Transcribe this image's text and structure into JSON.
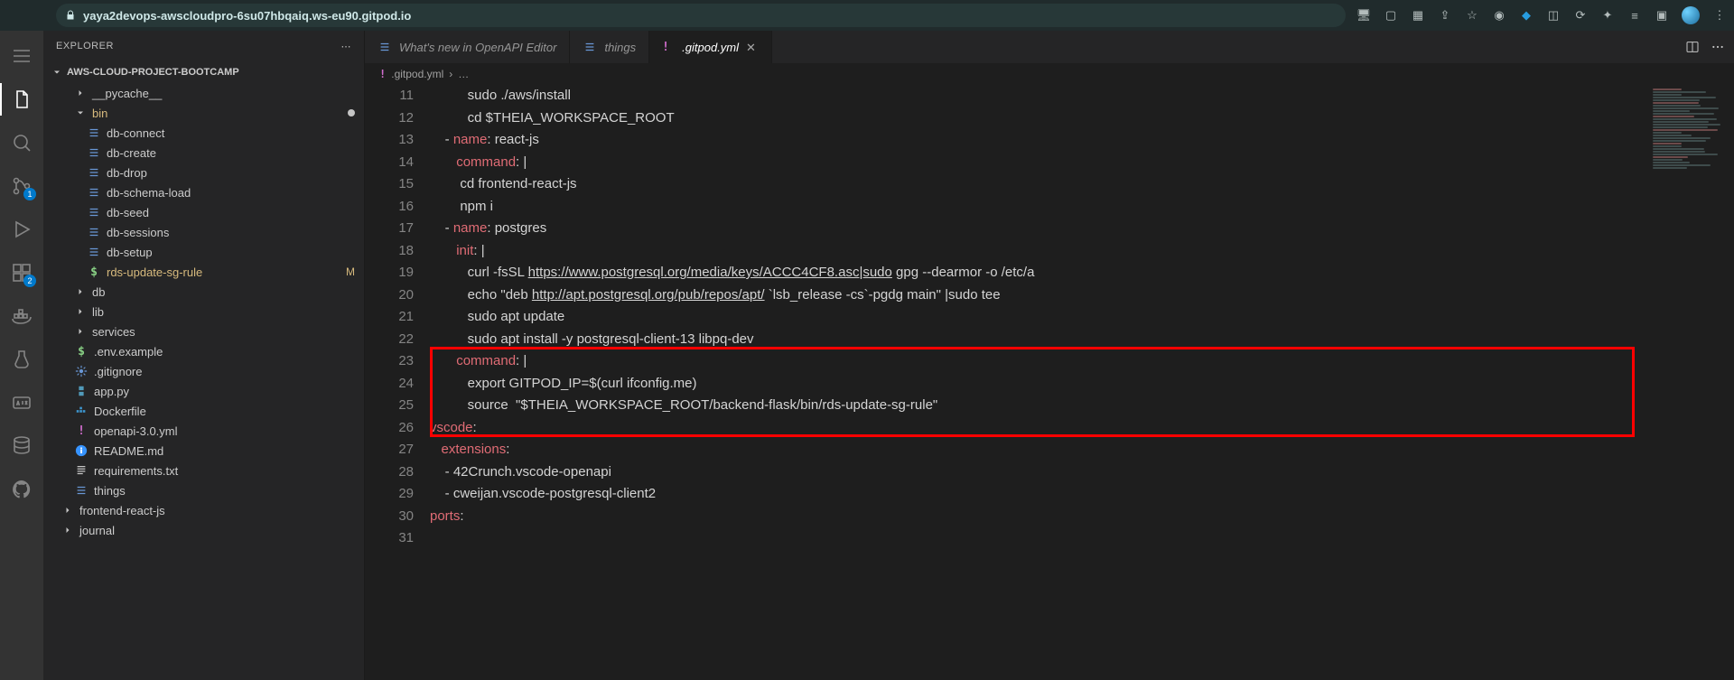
{
  "browser": {
    "url_host": "yaya2devops-awscloudpro-6su07hbqaiq.ws-eu90.gitpod.io"
  },
  "explorer": {
    "title": "EXPLORER",
    "repo": "AWS-CLOUD-PROJECT-BOOTCAMP",
    "items": [
      {
        "label": "__pycache__"
      },
      {
        "label": "bin"
      },
      {
        "label": "db-connect"
      },
      {
        "label": "db-create"
      },
      {
        "label": "db-drop"
      },
      {
        "label": "db-schema-load"
      },
      {
        "label": "db-seed"
      },
      {
        "label": "db-sessions"
      },
      {
        "label": "db-setup"
      },
      {
        "label": "rds-update-sg-rule",
        "status": "M"
      },
      {
        "label": "db"
      },
      {
        "label": "lib"
      },
      {
        "label": "services"
      },
      {
        "label": ".env.example"
      },
      {
        "label": ".gitignore"
      },
      {
        "label": "app.py"
      },
      {
        "label": "Dockerfile"
      },
      {
        "label": "openapi-3.0.yml"
      },
      {
        "label": "README.md"
      },
      {
        "label": "requirements.txt"
      },
      {
        "label": "things"
      },
      {
        "label": "frontend-react-js"
      },
      {
        "label": "journal"
      }
    ]
  },
  "tabs": [
    {
      "label": "What's new in OpenAPI Editor"
    },
    {
      "label": "things"
    },
    {
      "label": ".gitpod.yml",
      "active": true,
      "yaml_bang": "!"
    }
  ],
  "breadcrumb": {
    "bang": "!",
    "file": ".gitpod.yml",
    "more": "…"
  },
  "activity_badges": {
    "scm": "1",
    "ext": "2"
  },
  "code": {
    "first_line_no": 11,
    "lines": [
      {
        "n": 11,
        "t": "          sudo ./aws/install"
      },
      {
        "n": 12,
        "t": "          cd $THEIA_WORKSPACE_ROOT"
      },
      {
        "n": 13,
        "t": "    -",
        "key": "name",
        "rest": ": react-js"
      },
      {
        "n": 14,
        "t": "      ",
        "key": "command",
        "rest": ": ",
        "pipe": "|"
      },
      {
        "n": 15,
        "t": "        cd frontend-react-js"
      },
      {
        "n": 16,
        "t": "        npm i"
      },
      {
        "n": 17,
        "t": "    -",
        "key": "name",
        "rest": ": postgres"
      },
      {
        "n": 18,
        "t": "      ",
        "key": "init",
        "rest": ": ",
        "pipe": "|"
      },
      {
        "n": 19,
        "t": "          curl -fsSL ",
        "link": "https://www.postgresql.org/media/keys/ACCC4CF8.asc|sudo",
        "after": " gpg --dearmor -o /etc/a"
      },
      {
        "n": 20,
        "t": "          echo \"deb ",
        "link": "http://apt.postgresql.org/pub/repos/apt/",
        "after": " `lsb_release -cs`-pgdg main\" |sudo tee "
      },
      {
        "n": 21,
        "t": "          sudo apt update"
      },
      {
        "n": 22,
        "t": "          sudo apt install -y postgresql-client-13 libpq-dev"
      },
      {
        "n": 23,
        "t": "      ",
        "key": "command",
        "rest": ": ",
        "pipe": "|"
      },
      {
        "n": 24,
        "t": "          export GITPOD_IP=$(curl ifconfig.me)"
      },
      {
        "n": 25,
        "t": "          source  \"$THEIA_WORKSPACE_ROOT/backend-flask/bin/rds-update-sg-rule\""
      },
      {
        "n": 26,
        "sec": "vscode",
        "rest": ":"
      },
      {
        "n": 27,
        "t": "  ",
        "key": "extensions",
        "rest": ":"
      },
      {
        "n": 28,
        "t": "    - 42Crunch.vscode-openapi"
      },
      {
        "n": 29,
        "t": "    - cweijan.vscode-postgresql-client2"
      },
      {
        "n": 30,
        "t": ""
      },
      {
        "n": 31,
        "sec": "ports",
        "rest": ":"
      }
    ]
  }
}
